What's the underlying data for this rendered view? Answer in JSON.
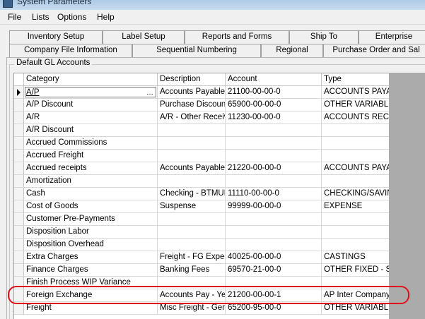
{
  "window": {
    "title": "System Parameters"
  },
  "menu": [
    "File",
    "Lists",
    "Options",
    "Help"
  ],
  "tabs_back": [
    "Inventory Setup",
    "Label Setup",
    "Reports and Forms",
    "Ship To",
    "Enterprise"
  ],
  "tabs_front": [
    "Company File Information",
    "Sequential Numbering",
    "Regional",
    "Purchase Order and Sal"
  ],
  "group": {
    "title": "Default GL Accounts"
  },
  "grid": {
    "columns": [
      "Category",
      "Description",
      "Account",
      "Type"
    ],
    "rows": [
      {
        "category": "A/P",
        "description": "Accounts Payable",
        "account": "21100-00-00-0",
        "type": "ACCOUNTS PAYAB"
      },
      {
        "category": "A/P Discount",
        "description": "Purchase Discount",
        "account": "65900-00-00-0",
        "type": "OTHER VARIABLE"
      },
      {
        "category": "A/R",
        "description": "A/R - Other Receiv",
        "account": "11230-00-00-0",
        "type": "ACCOUNTS RECEI"
      },
      {
        "category": "A/R Discount",
        "description": "",
        "account": "",
        "type": ""
      },
      {
        "category": "Accrued Commissions",
        "description": "",
        "account": "",
        "type": ""
      },
      {
        "category": "Accrued Freight",
        "description": "",
        "account": "",
        "type": ""
      },
      {
        "category": "Accrued receipts",
        "description": "Accounts Payable",
        "account": "21220-00-00-0",
        "type": "ACCOUNTS PAYAB"
      },
      {
        "category": "Amortization",
        "description": "",
        "account": "",
        "type": ""
      },
      {
        "category": "Cash",
        "description": "Checking - BTMUF",
        "account": "11110-00-00-0",
        "type": "CHECKING/SAVING"
      },
      {
        "category": "Cost of Goods",
        "description": "Suspense",
        "account": "99999-00-00-0",
        "type": "EXPENSE"
      },
      {
        "category": "Customer Pre-Payments",
        "description": "",
        "account": "",
        "type": ""
      },
      {
        "category": "Disposition Labor",
        "description": "",
        "account": "",
        "type": ""
      },
      {
        "category": "Disposition Overhead",
        "description": "",
        "account": "",
        "type": ""
      },
      {
        "category": "Extra Charges",
        "description": "Freight - FG Expec",
        "account": "40025-00-00-0",
        "type": "CASTINGS"
      },
      {
        "category": "Finance Charges",
        "description": "Banking Fees",
        "account": "69570-21-00-0",
        "type": "OTHER FIXED - SG"
      },
      {
        "category": "Finish Process WIP Variance",
        "description": "",
        "account": "",
        "type": ""
      },
      {
        "category": "Foreign Exchange",
        "description": "Accounts Pay - Yen",
        "account": "21200-00-00-1",
        "type": "AP Inter Company"
      },
      {
        "category": "Freight",
        "description": "Misc Freight - Gen",
        "account": "65200-95-00-0",
        "type": "OTHER VARIABLE"
      }
    ]
  },
  "colors": {
    "highlight": "#e0101a",
    "grid_background": "#ffffff",
    "empty_area": "#ababab"
  },
  "icons": {
    "dropdown": "dropdown-arrow-icon",
    "row_pointer": "current-row-icon"
  }
}
